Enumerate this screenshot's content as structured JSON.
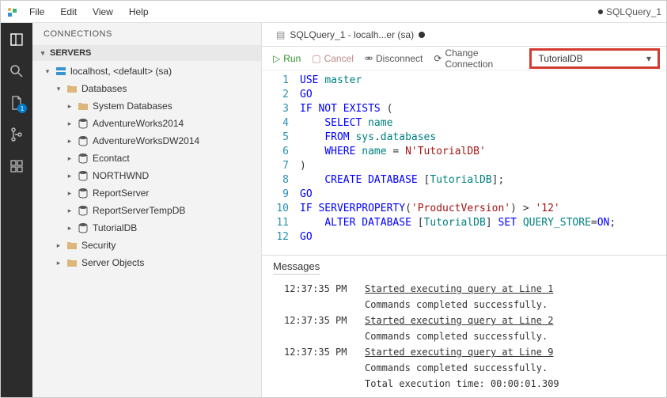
{
  "titlebar": {
    "menus": [
      "File",
      "Edit",
      "View",
      "Help"
    ],
    "right_label": "SQLQuery_1"
  },
  "activity": {
    "badge": "1"
  },
  "sidebar": {
    "title": "CONNECTIONS",
    "servers_label": "SERVERS",
    "server_node": "localhost, <default> (sa)",
    "databases_label": "Databases",
    "db_items": [
      "System Databases",
      "AdventureWorks2014",
      "AdventureWorksDW2014",
      "Econtact",
      "NORTHWND",
      "ReportServer",
      "ReportServerTempDB",
      "TutorialDB"
    ],
    "security_label": "Security",
    "server_objects_label": "Server Objects"
  },
  "tab": {
    "label": "SQLQuery_1 - localh...er (sa)"
  },
  "toolbar": {
    "run": "Run",
    "cancel": "Cancel",
    "disconnect": "Disconnect",
    "change_conn": "Change Connection",
    "db_selected": "TutorialDB"
  },
  "code": {
    "lines": [
      "USE master",
      "GO",
      "IF NOT EXISTS (",
      "    SELECT name",
      "    FROM sys.databases",
      "    WHERE name = N'TutorialDB'",
      ")",
      "    CREATE DATABASE [TutorialDB];",
      "GO",
      "IF SERVERPROPERTY('ProductVersion') > '12'",
      "    ALTER DATABASE [TutorialDB] SET QUERY_STORE=ON;",
      "GO"
    ]
  },
  "messages": {
    "title": "Messages",
    "rows": [
      {
        "time": "12:37:35 PM",
        "text": "Started executing query at Line 1",
        "link": true
      },
      {
        "time": "",
        "text": "Commands completed successfully.",
        "link": false
      },
      {
        "time": "12:37:35 PM",
        "text": "Started executing query at Line 2",
        "link": true
      },
      {
        "time": "",
        "text": "Commands completed successfully.",
        "link": false
      },
      {
        "time": "12:37:35 PM",
        "text": "Started executing query at Line 9",
        "link": true
      },
      {
        "time": "",
        "text": "Commands completed successfully.",
        "link": false
      },
      {
        "time": "",
        "text": "Total execution time: 00:00:01.309",
        "link": false
      }
    ]
  }
}
